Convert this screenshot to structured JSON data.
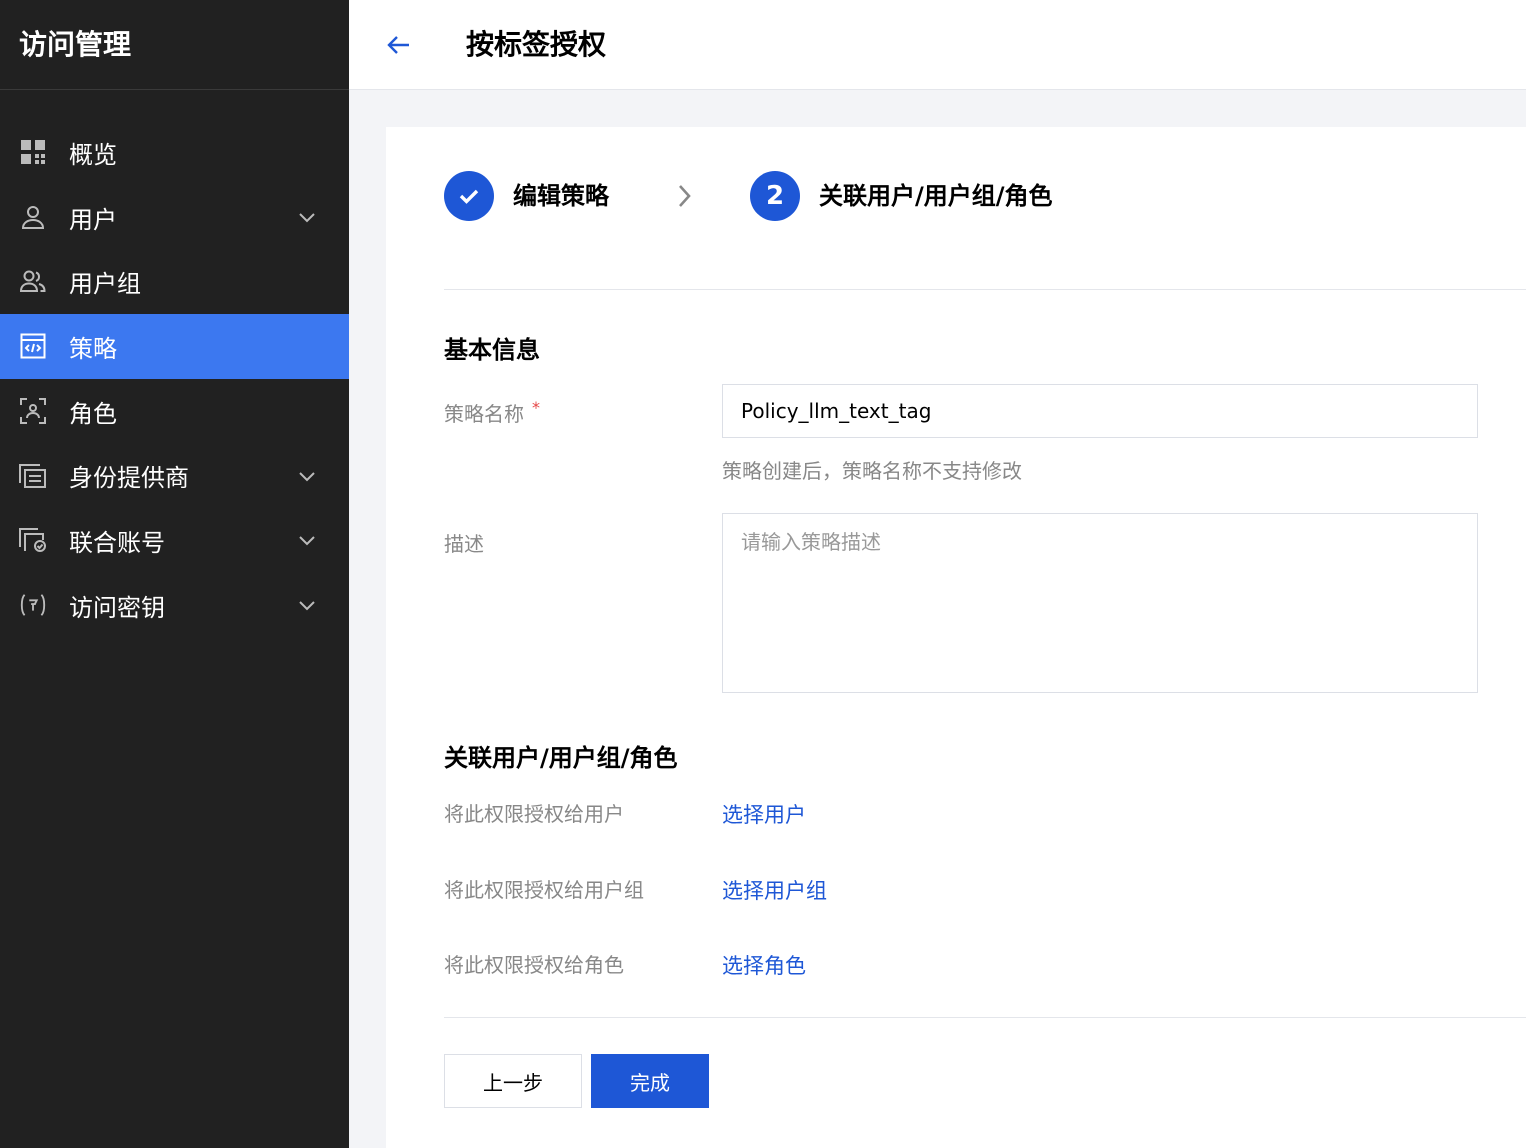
{
  "sidebar": {
    "title": "访问管理",
    "items": [
      {
        "label": "概览",
        "icon": "grid-icon",
        "expandable": false,
        "active": false
      },
      {
        "label": "用户",
        "icon": "user-icon",
        "expandable": true,
        "active": false
      },
      {
        "label": "用户组",
        "icon": "user-group-icon",
        "expandable": false,
        "active": false
      },
      {
        "label": "策略",
        "icon": "policy-icon",
        "expandable": false,
        "active": true
      },
      {
        "label": "角色",
        "icon": "role-icon",
        "expandable": false,
        "active": false
      },
      {
        "label": "身份提供商",
        "icon": "identity-provider-icon",
        "expandable": true,
        "active": false
      },
      {
        "label": "联合账号",
        "icon": "federated-account-icon",
        "expandable": true,
        "active": false
      },
      {
        "label": "访问密钥",
        "icon": "access-key-icon",
        "expandable": true,
        "active": false
      }
    ]
  },
  "header": {
    "back_icon": "arrow-left-icon",
    "title": "按标签授权"
  },
  "steps": {
    "step1": {
      "label": "编辑策略",
      "status": "completed",
      "icon": "check-icon"
    },
    "step2": {
      "label": "关联用户/用户组/角色",
      "status": "active",
      "number": "2"
    },
    "separator_icon": "chevron-right-icon"
  },
  "basic_info": {
    "title": "基本信息",
    "policy_name_label": "策略名称",
    "required_mark": "*",
    "policy_name_value": "Policy_llm_text_tag",
    "policy_name_hint": "策略创建后，策略名称不支持修改",
    "description_label": "描述",
    "description_placeholder": "请输入策略描述"
  },
  "associate": {
    "title": "关联用户/用户组/角色",
    "user_label": "将此权限授权给用户",
    "user_link": "选择用户",
    "group_label": "将此权限授权给用户组",
    "group_link": "选择用户组",
    "role_label": "将此权限授权给角色",
    "role_link": "选择角色"
  },
  "footer": {
    "prev_label": "上一步",
    "done_label": "完成"
  },
  "colors": {
    "sidebar_bg": "#212121",
    "active_item": "#3c78f0",
    "primary": "#1e57d6",
    "required": "#e54545"
  }
}
